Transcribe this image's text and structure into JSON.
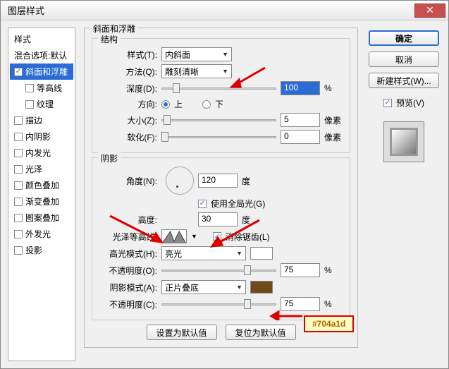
{
  "window": {
    "title": "图层样式"
  },
  "sidebar": {
    "head": "样式",
    "blend": "混合选项:默认",
    "items": [
      {
        "label": "斜面和浮雕",
        "checked": true,
        "selected": true
      },
      {
        "label": "等高线",
        "checked": false,
        "indent": true
      },
      {
        "label": "纹理",
        "checked": false,
        "indent": true
      },
      {
        "label": "描边",
        "checked": false
      },
      {
        "label": "内阴影",
        "checked": false
      },
      {
        "label": "内发光",
        "checked": false
      },
      {
        "label": "光泽",
        "checked": false
      },
      {
        "label": "颜色叠加",
        "checked": false
      },
      {
        "label": "渐变叠加",
        "checked": false
      },
      {
        "label": "图案叠加",
        "checked": false
      },
      {
        "label": "外发光",
        "checked": false
      },
      {
        "label": "投影",
        "checked": false
      }
    ]
  },
  "main": {
    "groupTitle": "斜面和浮雕",
    "structure": {
      "title": "结构",
      "styleLabel": "样式(T):",
      "styleValue": "内斜面",
      "methodLabel": "方法(Q):",
      "methodValue": "雕刻清晰",
      "depthLabel": "深度(D):",
      "depthValue": "100",
      "depthUnit": "%",
      "dirLabel": "方向:",
      "upLabel": "上",
      "downLabel": "下",
      "sizeLabel": "大小(Z):",
      "sizeValue": "5",
      "sizeUnit": "像素",
      "softenLabel": "软化(F):",
      "softenValue": "0",
      "softenUnit": "像素"
    },
    "shading": {
      "title": "阴影",
      "angleLabel": "角度(N):",
      "angleValue": "120",
      "angleUnit": "度",
      "globalLabel": "使用全局光(G)",
      "altLabel": "高度:",
      "altValue": "30",
      "altUnit": "度",
      "glossLabel": "光泽等高线:",
      "antiLabel": "消除锯齿(L)",
      "hlModeLabel": "高光模式(H):",
      "hlModeValue": "亮光",
      "hlOpLabel": "不透明度(O):",
      "hlOpValue": "75",
      "hlOpUnit": "%",
      "shModeLabel": "阴影模式(A):",
      "shModeValue": "正片叠底",
      "shOpLabel": "不透明度(C):",
      "shOpValue": "75",
      "shOpUnit": "%"
    },
    "defaultsBtn": "设置为默认值",
    "resetBtn": "复位为默认值"
  },
  "right": {
    "ok": "确定",
    "cancel": "取消",
    "newStyle": "新建样式(W)...",
    "previewLabel": "预览(V)"
  },
  "annotation": {
    "hex": "#704a1d"
  },
  "colors": {
    "shadowSwatch": "#704a1d",
    "hlSwatch": "#ffffff"
  }
}
